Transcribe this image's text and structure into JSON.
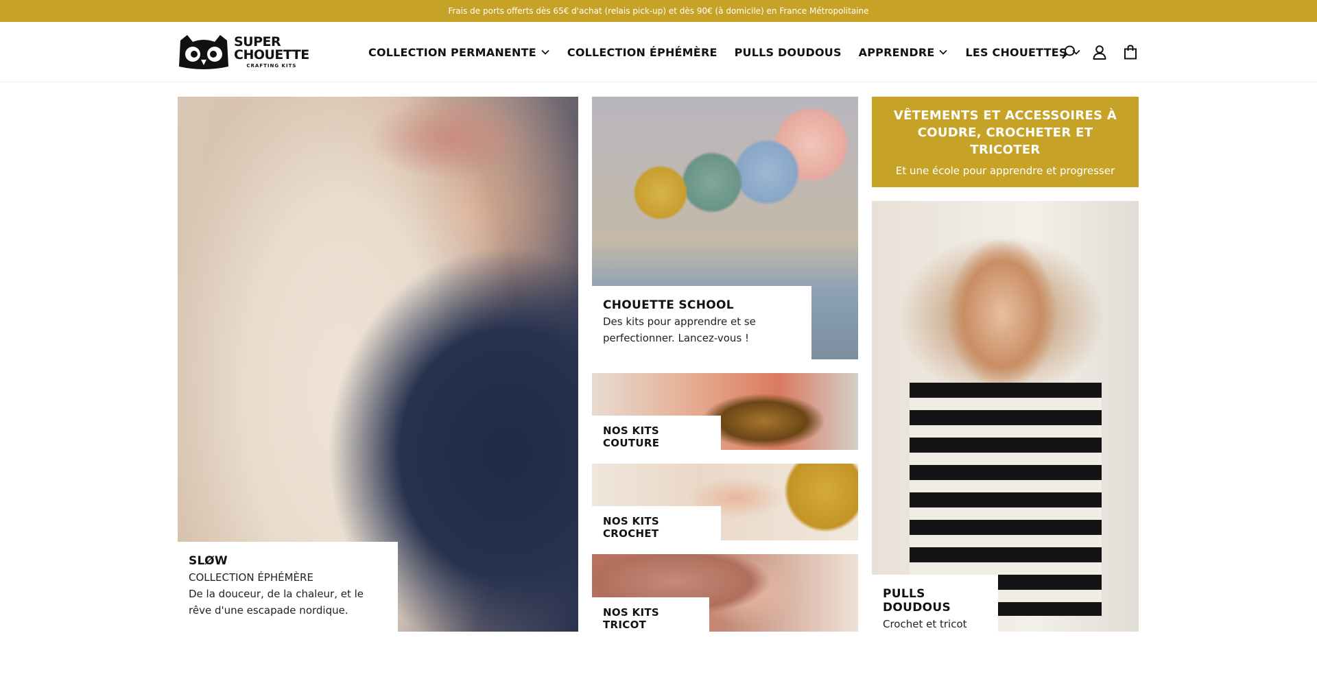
{
  "announcement": "Frais de ports offerts dès 65€ d'achat (relais pick-up) et dès 90€ (à domicile) en France Métropolitaine",
  "brand": {
    "name_line1": "SUPER",
    "name_line2": "CHOUETTE",
    "tagline": "CRAFTING KITS"
  },
  "nav": {
    "items": [
      {
        "label": "COLLECTION PERMANENTE",
        "has_dropdown": true
      },
      {
        "label": "COLLECTION ÉPHÉMÈRE",
        "has_dropdown": false
      },
      {
        "label": "PULLS DOUDOUS",
        "has_dropdown": false
      },
      {
        "label": "APPRENDRE",
        "has_dropdown": true
      },
      {
        "label": "LES CHOUETTES",
        "has_dropdown": true
      }
    ]
  },
  "header_icons": [
    "search-icon",
    "account-icon",
    "cart-icon"
  ],
  "tiles": {
    "slow": {
      "title": "SLØW",
      "subtitle": "COLLECTION ÉPHÉMÈRE",
      "description": "De la douceur, de la chaleur, et le rêve d'une escapade nordique."
    },
    "school": {
      "title": "CHOUETTE SCHOOL",
      "description": "Des kits pour apprendre et se perfectionner. Lancez-vous !"
    },
    "couture": {
      "title": "NOS KITS COUTURE"
    },
    "crochet": {
      "title": "NOS KITS CROCHET"
    },
    "tricot": {
      "title": "NOS KITS TRICOT"
    },
    "promo": {
      "title": "VÊTEMENTS ET ACCESSOIRES À COUDRE, CROCHETER ET TRICOTER",
      "subtitle": "Et une école pour apprendre et progresser"
    },
    "pulls": {
      "title": "PULLS DOUDOUS",
      "description": "Crochet et tricot"
    }
  },
  "colors": {
    "accent": "#c6a227",
    "text": "#111111",
    "background": "#ffffff"
  }
}
